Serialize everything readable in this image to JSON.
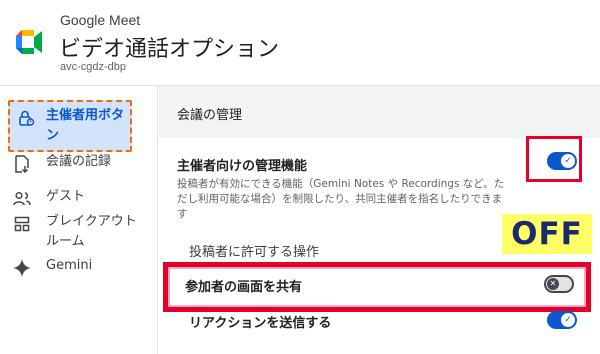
{
  "header": {
    "app_name": "Google Meet",
    "title": "ビデオ通話オプション",
    "meeting_code": "avc-cgdz-dbp"
  },
  "sidebar": {
    "items": [
      {
        "label": "主催者用ボタン",
        "icon": "lock-person-icon",
        "selected": true
      },
      {
        "label": "会議の記録",
        "icon": "record-icon"
      },
      {
        "label": "ゲスト",
        "icon": "people-icon"
      },
      {
        "label": "ブレイクアウトルーム",
        "icon": "grid-icon"
      },
      {
        "label": "Gemini",
        "icon": "gemini-sparkle-icon"
      }
    ]
  },
  "main": {
    "section_title": "会議の管理",
    "host_management": {
      "label": "主催者向けの管理機能",
      "description": "投稿者が有効にできる機能（Gemini Notes や Recordings など。ただし利用可能な場合）を制限したり、共同主催者を指名したりできます",
      "toggle_on": true
    },
    "allow_section_label": "投稿者に許可する操作",
    "annotation_off": "OFF",
    "share_screen": {
      "label": "参加者の画面を共有",
      "toggle_on": false
    },
    "send_reactions": {
      "label": "リアクションを送信する",
      "toggle_on": true
    }
  },
  "colors": {
    "accent": "#0b57d0",
    "highlight_red": "#e4002b",
    "selected_bg": "#d3e3fd",
    "dashed_orange": "#e8710a",
    "off_badge_bg": "#ffff66",
    "off_badge_text": "#1a2a6c"
  }
}
